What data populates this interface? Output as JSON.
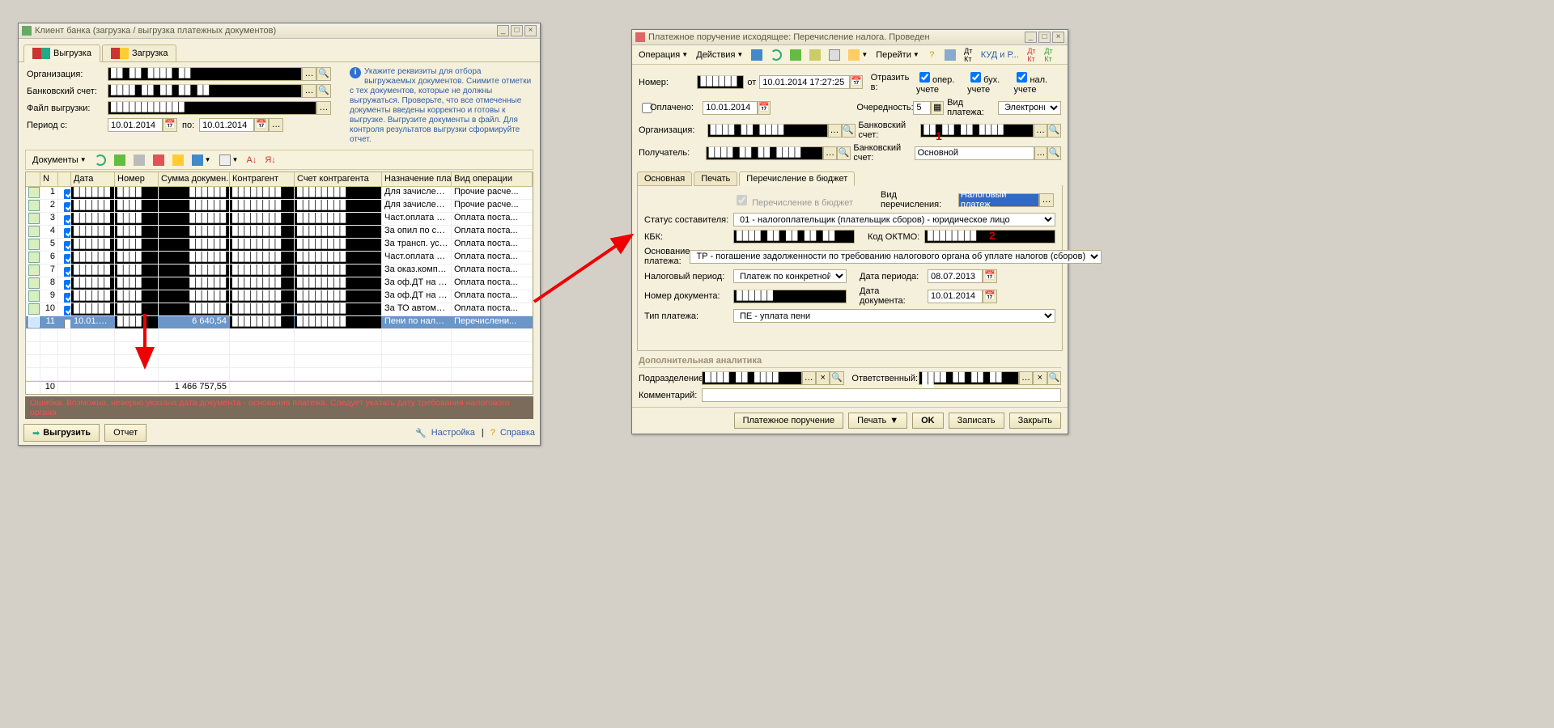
{
  "win1": {
    "title": "Клиент банка (загрузка / выгрузка платежных документов)",
    "tabs": {
      "out": "Выгрузка",
      "in": "Загрузка"
    },
    "org_label": "Организация:",
    "acct_label": "Банковский счет:",
    "file_label": "Файл выгрузки:",
    "period_label": "Период с:",
    "period_to": "по:",
    "period_from_val": "10.01.2014",
    "period_to_val": "10.01.2014",
    "hint": "Укажите реквизиты для отбора выгружаемых документов. Снимите отметки с тех документов, которые не должны выгружаться. Проверьте, что все отмеченные документы введены корректно и готовы к выгрузке. Выгрузите документы в файл. Для контроля результатов выгрузки сформируйте отчет.",
    "docmenu": "Документы",
    "cols": [
      "",
      "N",
      "",
      "Дата",
      "Номер",
      "Сумма докумен...",
      "Контрагент",
      "Счет контрагента",
      "Назначение плат...",
      "Вид операции"
    ],
    "rows": [
      {
        "n": "1",
        "chk": true,
        "date": "██████",
        "num": "████",
        "sum": "██████",
        "ka": "████████",
        "acct": "████████",
        "purpose": "Для зачисления ...",
        "op": "Прочие расче..."
      },
      {
        "n": "2",
        "chk": true,
        "date": "██████",
        "num": "████",
        "sum": "██████",
        "ka": "████████",
        "acct": "████████",
        "purpose": "Для зачисления ...",
        "op": "Прочие расче..."
      },
      {
        "n": "3",
        "chk": true,
        "date": "██████",
        "num": "████",
        "sum": "██████",
        "ka": "████████",
        "acct": "████████",
        "purpose": "Част.оплата яйц...",
        "op": "Оплата поста..."
      },
      {
        "n": "4",
        "chk": true,
        "date": "██████",
        "num": "████",
        "sum": "██████",
        "ka": "████████",
        "acct": "████████",
        "purpose": "За опил по сч. №...",
        "op": "Оплата поста..."
      },
      {
        "n": "5",
        "chk": true,
        "date": "██████",
        "num": "████",
        "sum": "██████",
        "ka": "████████",
        "acct": "████████",
        "purpose": "За трансп. услуг...",
        "op": "Оплата поста..."
      },
      {
        "n": "6",
        "chk": true,
        "date": "██████",
        "num": "████",
        "sum": "██████",
        "ka": "████████",
        "acct": "████████",
        "purpose": "Част.оплата за о...",
        "op": "Оплата поста..."
      },
      {
        "n": "7",
        "chk": true,
        "date": "██████",
        "num": "████",
        "sum": "██████",
        "ka": "████████",
        "acct": "████████",
        "purpose": "За оказ.компл.у...",
        "op": "Оплата поста..."
      },
      {
        "n": "8",
        "chk": true,
        "date": "██████",
        "num": "████",
        "sum": "██████",
        "ka": "████████",
        "acct": "████████",
        "purpose": "За оф.ДТ на вво...",
        "op": "Оплата поста..."
      },
      {
        "n": "9",
        "chk": true,
        "date": "██████",
        "num": "████",
        "sum": "██████",
        "ka": "████████",
        "acct": "████████",
        "purpose": "За оф.ДТ на вво...",
        "op": "Оплата поста..."
      },
      {
        "n": "10",
        "chk": true,
        "date": "██████",
        "num": "████",
        "sum": "██████",
        "ka": "████████",
        "acct": "████████",
        "purpose": "За ТО автомоби...",
        "op": "Оплата поста..."
      },
      {
        "n": "11",
        "chk": false,
        "date": "10.01.2014",
        "num": "████",
        "sum": "6 640,54",
        "ka": "████████",
        "acct": "████████",
        "purpose": "Пени по налогу н...",
        "op": "Перечислени...",
        "sel": true
      }
    ],
    "total_n": "10",
    "total_sum": "1 466 757,55",
    "error": "Ошибка: Возможно, неверно указана дата документа - основания платежа. Следует указать дату требования налогового органа",
    "btn_export": "Выгрузить",
    "btn_report": "Отчет",
    "lnk_settings": "Настройка",
    "lnk_help": "Справка"
  },
  "win2": {
    "title": "Платежное поручение исходящее: Перечисление налога. Проведен",
    "menu": {
      "op": "Операция",
      "act": "Действия",
      "go": "Перейти",
      "kud": "КУД и Р..."
    },
    "num_label": "Номер:",
    "num_from": "от",
    "num_date": "10.01.2014 17:27:25",
    "refl_label": "Отразить в:",
    "refl_oper": "опер. учете",
    "refl_buh": "бух. учете",
    "refl_nal": "нал. учете",
    "paid_label": "Оплачено:",
    "paid_date": "10.01.2014",
    "queue_label": "Очередность:",
    "queue_val": "5",
    "paytype_label": "Вид платежа:",
    "paytype_val": "Электронно",
    "org_label": "Организация:",
    "bankacct_label": "Банковский счет:",
    "recip_label": "Получатель:",
    "bankacct2_val": "Основной",
    "subtabs": {
      "main": "Основная",
      "print": "Печать",
      "budget": "Перечисление в бюджет"
    },
    "budget_chk": "Перечисление в бюджет",
    "transtype_label": "Вид перечисления:",
    "transtype_val": "Налоговый платеж",
    "status_label": "Статус составителя:",
    "status_val": "01 - налогоплательщик (плательщик сборов) - юридическое лицо",
    "kbk_label": "КБК:",
    "oktmo_label": "Код ОКТМО:",
    "basis_label": "Основание платежа:",
    "basis_val": "ТР - погашение задолженности по требованию налогового органа об уплате налогов (сборов)",
    "taxperiod_label": "Налоговый период:",
    "taxperiod_val": "Платеж по конкретной дате",
    "perioddate_label": "Дата периода:",
    "perioddate_val": "08.07.2013",
    "docnum_label": "Номер документа:",
    "docdate_label": "Дата документа:",
    "docdate_val": "10.01.2014",
    "paytype2_label": "Тип платежа:",
    "paytype2_val": "ПЕ - уплата пени",
    "addan_label": "Дополнительная аналитика",
    "subdiv_label": "Подразделение:",
    "resp_label": "Ответственный:",
    "comment_label": "Комментарий:",
    "footer": {
      "pp": "Платежное поручение",
      "print": "Печать",
      "ok": "OK",
      "save": "Записать",
      "close": "Закрыть"
    }
  }
}
